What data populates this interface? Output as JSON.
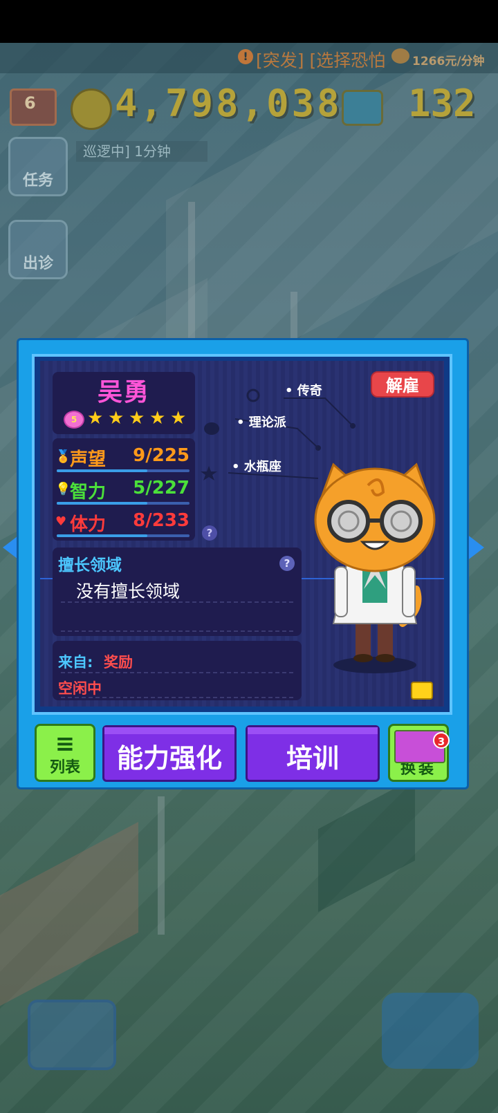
{
  "hud": {
    "news_text": "[突发] [选择恐怕",
    "income_rate": "1266元/分钟",
    "level": "6",
    "money": "4,798,038",
    "gems": "132",
    "patrol_status": "巡逻中] 1分钟",
    "task_label": "任务",
    "outcall_label": "出诊"
  },
  "doctor": {
    "name": "吴勇",
    "rank_badge": "5",
    "stars": 5,
    "stats": [
      {
        "label": "声望",
        "value": "9/225",
        "color": "#ff9a1a",
        "progress": 0.04
      },
      {
        "label": "智力",
        "value": "5/227",
        "color": "#4be03a",
        "progress": 0.02
      },
      {
        "label": "体力",
        "value": "8/233",
        "color": "#ff3b3b",
        "progress": 0.03
      }
    ],
    "specialty_title": "擅长领域",
    "specialty_value": "没有擅长领域",
    "from_label": "来自:",
    "from_value": "奖励",
    "status": "空闲中",
    "traits": [
      "传奇",
      "理论派",
      "水瓶座"
    ]
  },
  "buttons": {
    "fire": "解雇",
    "list": "列表",
    "enhance": "能力强化",
    "train": "培训",
    "dress": "换装",
    "dress_badge": "3"
  },
  "icons": {
    "help": "?",
    "list": "≡",
    "alert": "!",
    "star": "★"
  },
  "colors": {
    "name": "#ff55d8",
    "accent_blue": "#4cc7ff",
    "fire_red": "#e8464a",
    "button_purple": "#7e2fe6",
    "button_green": "#8bf04a"
  }
}
